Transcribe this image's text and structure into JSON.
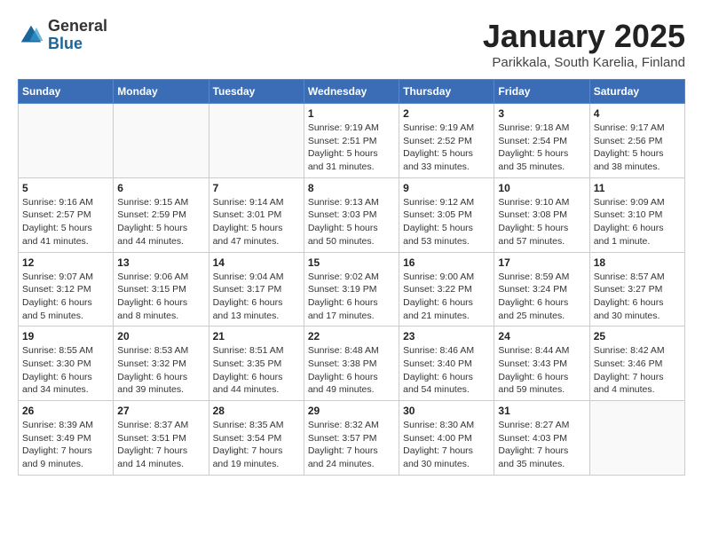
{
  "header": {
    "logo": {
      "general": "General",
      "blue": "Blue"
    },
    "title": "January 2025",
    "location": "Parikkala, South Karelia, Finland"
  },
  "weekdays": [
    "Sunday",
    "Monday",
    "Tuesday",
    "Wednesday",
    "Thursday",
    "Friday",
    "Saturday"
  ],
  "weeks": [
    [
      {
        "day": "",
        "info": ""
      },
      {
        "day": "",
        "info": ""
      },
      {
        "day": "",
        "info": ""
      },
      {
        "day": "1",
        "info": "Sunrise: 9:19 AM\nSunset: 2:51 PM\nDaylight: 5 hours\nand 31 minutes."
      },
      {
        "day": "2",
        "info": "Sunrise: 9:19 AM\nSunset: 2:52 PM\nDaylight: 5 hours\nand 33 minutes."
      },
      {
        "day": "3",
        "info": "Sunrise: 9:18 AM\nSunset: 2:54 PM\nDaylight: 5 hours\nand 35 minutes."
      },
      {
        "day": "4",
        "info": "Sunrise: 9:17 AM\nSunset: 2:56 PM\nDaylight: 5 hours\nand 38 minutes."
      }
    ],
    [
      {
        "day": "5",
        "info": "Sunrise: 9:16 AM\nSunset: 2:57 PM\nDaylight: 5 hours\nand 41 minutes."
      },
      {
        "day": "6",
        "info": "Sunrise: 9:15 AM\nSunset: 2:59 PM\nDaylight: 5 hours\nand 44 minutes."
      },
      {
        "day": "7",
        "info": "Sunrise: 9:14 AM\nSunset: 3:01 PM\nDaylight: 5 hours\nand 47 minutes."
      },
      {
        "day": "8",
        "info": "Sunrise: 9:13 AM\nSunset: 3:03 PM\nDaylight: 5 hours\nand 50 minutes."
      },
      {
        "day": "9",
        "info": "Sunrise: 9:12 AM\nSunset: 3:05 PM\nDaylight: 5 hours\nand 53 minutes."
      },
      {
        "day": "10",
        "info": "Sunrise: 9:10 AM\nSunset: 3:08 PM\nDaylight: 5 hours\nand 57 minutes."
      },
      {
        "day": "11",
        "info": "Sunrise: 9:09 AM\nSunset: 3:10 PM\nDaylight: 6 hours\nand 1 minute."
      }
    ],
    [
      {
        "day": "12",
        "info": "Sunrise: 9:07 AM\nSunset: 3:12 PM\nDaylight: 6 hours\nand 5 minutes."
      },
      {
        "day": "13",
        "info": "Sunrise: 9:06 AM\nSunset: 3:15 PM\nDaylight: 6 hours\nand 8 minutes."
      },
      {
        "day": "14",
        "info": "Sunrise: 9:04 AM\nSunset: 3:17 PM\nDaylight: 6 hours\nand 13 minutes."
      },
      {
        "day": "15",
        "info": "Sunrise: 9:02 AM\nSunset: 3:19 PM\nDaylight: 6 hours\nand 17 minutes."
      },
      {
        "day": "16",
        "info": "Sunrise: 9:00 AM\nSunset: 3:22 PM\nDaylight: 6 hours\nand 21 minutes."
      },
      {
        "day": "17",
        "info": "Sunrise: 8:59 AM\nSunset: 3:24 PM\nDaylight: 6 hours\nand 25 minutes."
      },
      {
        "day": "18",
        "info": "Sunrise: 8:57 AM\nSunset: 3:27 PM\nDaylight: 6 hours\nand 30 minutes."
      }
    ],
    [
      {
        "day": "19",
        "info": "Sunrise: 8:55 AM\nSunset: 3:30 PM\nDaylight: 6 hours\nand 34 minutes."
      },
      {
        "day": "20",
        "info": "Sunrise: 8:53 AM\nSunset: 3:32 PM\nDaylight: 6 hours\nand 39 minutes."
      },
      {
        "day": "21",
        "info": "Sunrise: 8:51 AM\nSunset: 3:35 PM\nDaylight: 6 hours\nand 44 minutes."
      },
      {
        "day": "22",
        "info": "Sunrise: 8:48 AM\nSunset: 3:38 PM\nDaylight: 6 hours\nand 49 minutes."
      },
      {
        "day": "23",
        "info": "Sunrise: 8:46 AM\nSunset: 3:40 PM\nDaylight: 6 hours\nand 54 minutes."
      },
      {
        "day": "24",
        "info": "Sunrise: 8:44 AM\nSunset: 3:43 PM\nDaylight: 6 hours\nand 59 minutes."
      },
      {
        "day": "25",
        "info": "Sunrise: 8:42 AM\nSunset: 3:46 PM\nDaylight: 7 hours\nand 4 minutes."
      }
    ],
    [
      {
        "day": "26",
        "info": "Sunrise: 8:39 AM\nSunset: 3:49 PM\nDaylight: 7 hours\nand 9 minutes."
      },
      {
        "day": "27",
        "info": "Sunrise: 8:37 AM\nSunset: 3:51 PM\nDaylight: 7 hours\nand 14 minutes."
      },
      {
        "day": "28",
        "info": "Sunrise: 8:35 AM\nSunset: 3:54 PM\nDaylight: 7 hours\nand 19 minutes."
      },
      {
        "day": "29",
        "info": "Sunrise: 8:32 AM\nSunset: 3:57 PM\nDaylight: 7 hours\nand 24 minutes."
      },
      {
        "day": "30",
        "info": "Sunrise: 8:30 AM\nSunset: 4:00 PM\nDaylight: 7 hours\nand 30 minutes."
      },
      {
        "day": "31",
        "info": "Sunrise: 8:27 AM\nSunset: 4:03 PM\nDaylight: 7 hours\nand 35 minutes."
      },
      {
        "day": "",
        "info": ""
      }
    ]
  ]
}
